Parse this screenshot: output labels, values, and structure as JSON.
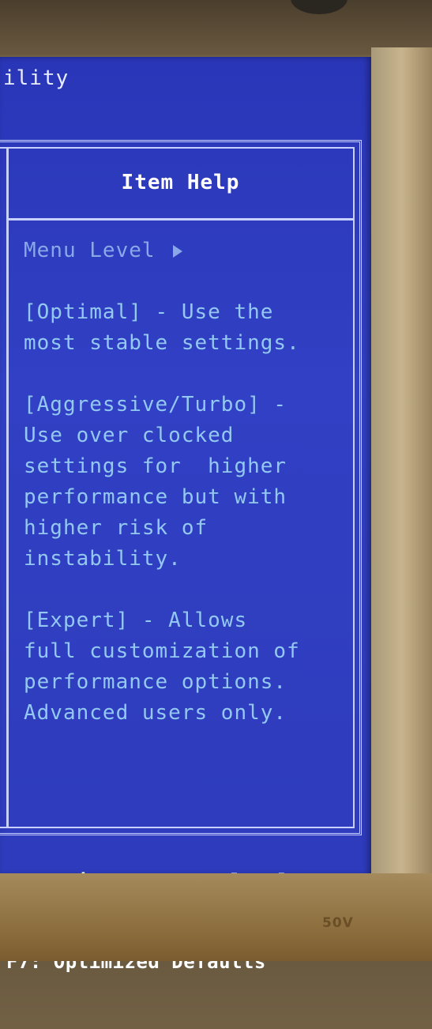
{
  "window": {
    "title": "ility"
  },
  "help_panel": {
    "header": "Item Help",
    "menu_level_label": "Menu Level",
    "paragraphs": [
      "[Optimal] - Use the\nmost stable settings.",
      "[Aggressive/Turbo] -\nUse over clocked\nsettings for  higher\nperformance but with\nhigher risk of\ninstability.",
      "[Expert] - Allows\nfull customization of\nperformance options.\nAdvanced users only."
    ]
  },
  "footer": {
    "line1": "ESC:Exit  F1:General Help",
    "line2": "F7: Optimized Defaults"
  },
  "monitor": {
    "bezel_label": "50V"
  },
  "colors": {
    "screen_bg": "#2e3bbc",
    "help_text": "#93c8f0",
    "header_text": "#ffffff",
    "border": "#c8d0ff"
  }
}
